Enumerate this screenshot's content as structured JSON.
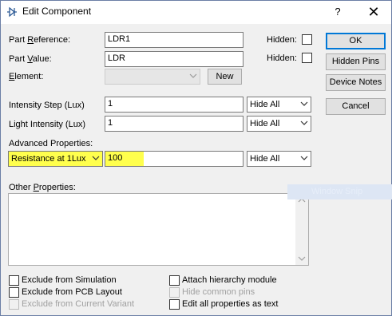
{
  "window": {
    "title": "Edit Component",
    "help_glyph": "?",
    "close_glyph": "✕"
  },
  "fields": {
    "part_reference": {
      "label_pre": "Part ",
      "label_u": "R",
      "label_post": "eference:",
      "value": "LDR1",
      "hidden_label": "Hidden:"
    },
    "part_value": {
      "label_pre": "Part ",
      "label_u": "V",
      "label_post": "alue:",
      "value": "LDR",
      "hidden_label": "Hidden:"
    },
    "element": {
      "label_pre": "",
      "label_u": "E",
      "label_post": "lement:",
      "value": "",
      "new_button": "New"
    }
  },
  "properties": [
    {
      "label": "Intensity Step (Lux)",
      "value": "1",
      "visibility": "Hide All"
    },
    {
      "label": "Light Intensity (Lux)",
      "value": "1",
      "visibility": "Hide All"
    }
  ],
  "advanced": {
    "title": "Advanced Properties:",
    "selected": "Resistance at 1Lux",
    "value": "100",
    "visibility": "Hide All"
  },
  "other": {
    "label_pre": "Other ",
    "label_u": "P",
    "label_post": "roperties:",
    "value": ""
  },
  "buttons": {
    "ok": "OK",
    "hidden_pins": "Hidden Pins",
    "device_notes": "Device Notes",
    "cancel": "Cancel"
  },
  "options_left": [
    {
      "label": "Exclude from Simulation",
      "enabled": true
    },
    {
      "label": "Exclude from PCB Layout",
      "enabled": true
    },
    {
      "label": "Exclude from Current Variant",
      "enabled": false
    }
  ],
  "options_right": [
    {
      "label": "Attach hierarchy module",
      "enabled": true
    },
    {
      "label": "Hide common pins",
      "enabled": false
    },
    {
      "label": "Edit all properties as text",
      "enabled": true
    }
  ],
  "watermark": "Window Snip",
  "colors": {
    "highlight": "#ffff4d",
    "default_button_border": "#0078d7"
  }
}
